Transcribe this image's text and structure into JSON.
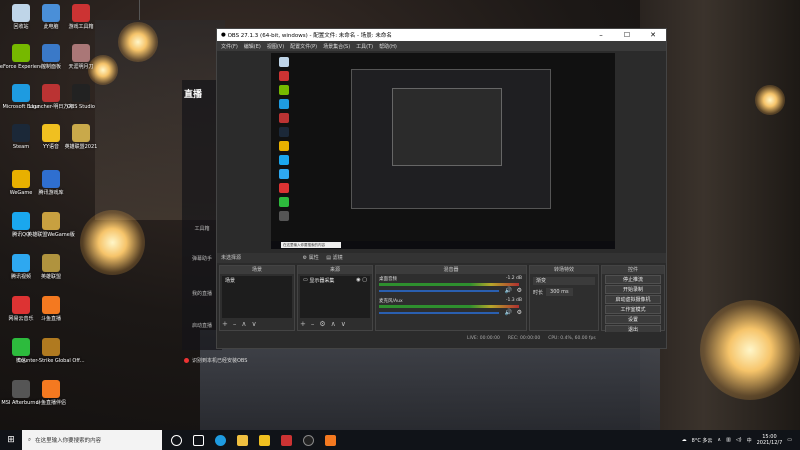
{
  "desktop_icons": [
    {
      "label": "回收站",
      "color": "#bfd5e8"
    },
    {
      "label": "此电脑",
      "color": "#4a8fd8"
    },
    {
      "label": "游戏工具箱",
      "color": "#c33"
    },
    {
      "label": "GeForce Experience",
      "color": "#76b900"
    },
    {
      "label": "控制面板",
      "color": "#3a79c8"
    },
    {
      "label": "天涯明月刀",
      "color": "#a77"
    },
    {
      "label": "Microsoft Edge",
      "color": "#1e9be0"
    },
    {
      "label": "Launcher-明日方舟",
      "color": "#b33"
    },
    {
      "label": "OBS Studio",
      "color": "#222"
    },
    {
      "label": "Steam",
      "color": "#1b2838"
    },
    {
      "label": "YY语音",
      "color": "#f0c020"
    },
    {
      "label": "英雄联盟2021",
      "color": "#c9a94a"
    },
    {
      "label": "WeGame",
      "color": "#e8b000"
    },
    {
      "label": "腾讯游戏库",
      "color": "#2f6fd0"
    },
    {
      "label": "腾讯QQ",
      "color": "#1aa7ee"
    },
    {
      "label": "英雄联盟WeGame版",
      "color": "#c8a040"
    },
    {
      "label": "腾讯视频",
      "color": "#2ea8f0"
    },
    {
      "label": "英雄联盟",
      "color": "#b0933e"
    },
    {
      "label": "网易云音乐",
      "color": "#d33"
    },
    {
      "label": "斗鱼直播",
      "color": "#f47920"
    },
    {
      "label": "微信",
      "color": "#2dbb3d"
    },
    {
      "label": "Counter-Strike Global Off...",
      "color": "#b07a20"
    },
    {
      "label": "MSI Afterburner",
      "color": "#555"
    },
    {
      "label": "斗鱼直播伴侣",
      "color": "#f47920"
    }
  ],
  "streamer_panel": {
    "logo": "直播",
    "items": [
      "工具箱",
      "弹幕助手",
      "我的直播",
      "启动直播"
    ]
  },
  "obs": {
    "title": "OBS 27.1.3 (64-bit, windows) - 配置文件: 未命名 - 场景: 未命名",
    "menu": [
      "文件(F)",
      "编辑(E)",
      "视图(V)",
      "配置文件(P)",
      "场景集合(S)",
      "工具(T)",
      "帮助(H)"
    ],
    "dock_bar": "未选择源",
    "dock_bar_btns": [
      "属性",
      "滤镜"
    ],
    "docks": {
      "scenes": {
        "title": "场景",
        "items": [
          "场景"
        ]
      },
      "sources": {
        "title": "来源",
        "items": [
          "显示器采集"
        ]
      },
      "mixer": {
        "title": "混音器",
        "tracks": [
          {
            "name": "桌面音频",
            "db": "-1.2 dB"
          },
          {
            "name": "麦克风/Aux",
            "db": "-1.3 dB"
          }
        ]
      },
      "transitions": {
        "title": "转场特效",
        "type": "渐变",
        "duration_label": "时长",
        "duration": "300 ms"
      },
      "controls": {
        "title": "控件",
        "buttons": [
          "停止推流",
          "开始录制",
          "启动虚拟摄像机",
          "工作室模式",
          "设置",
          "退出"
        ]
      }
    },
    "status": [
      "LIVE: 00:00:00",
      "REC: 00:00:00",
      "CPU: 0.4%, 60.00 fps"
    ]
  },
  "toast": "识别到本机已经安装OBS",
  "taskbar": {
    "search_placeholder": "在这里输入你要搜索的内容",
    "tray_weather": "8°C 多云",
    "tray_lang": "中",
    "time": "15:00",
    "date": "2021/12/7"
  }
}
